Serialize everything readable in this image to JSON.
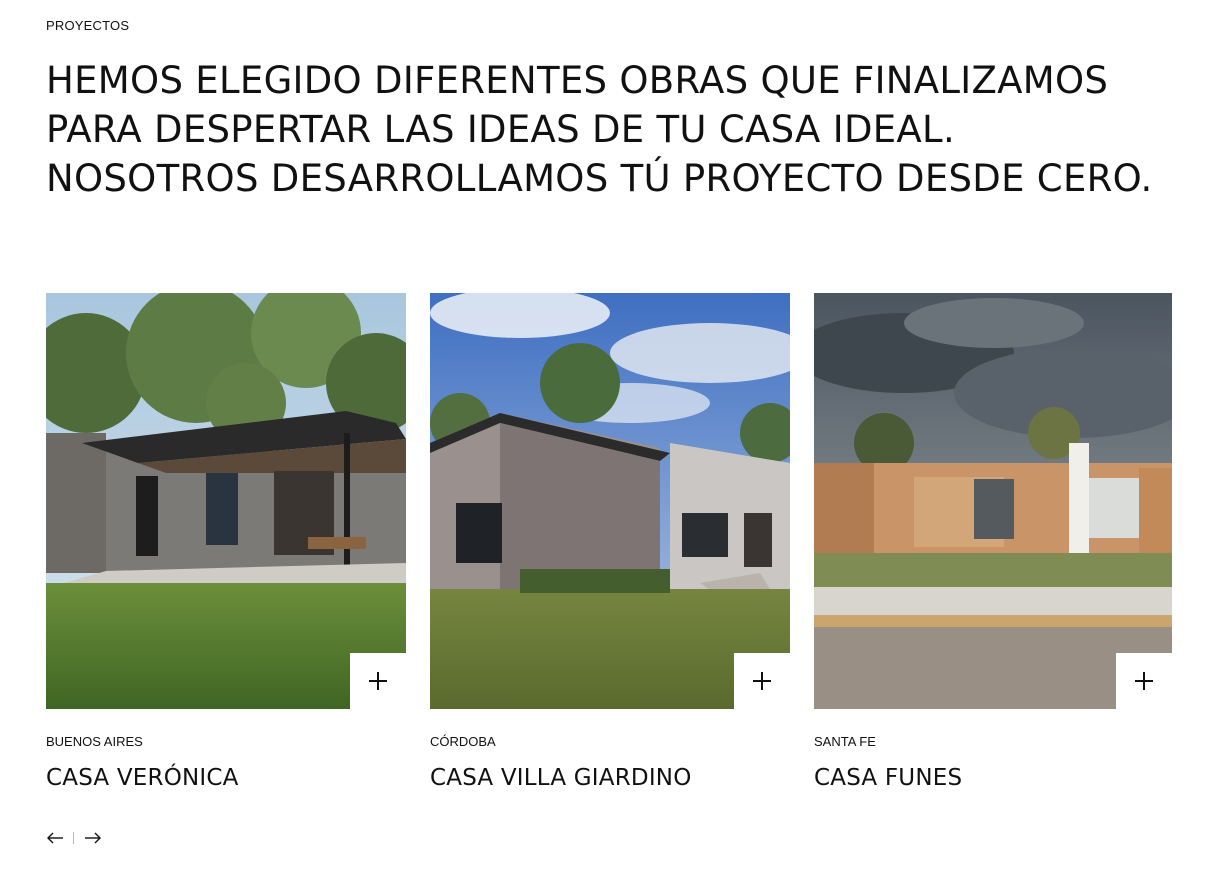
{
  "section": {
    "label": "PROYECTOS",
    "headline": "HEMOS ELEGIDO DIFERENTES OBRAS QUE FINALIZAMOS PARA DESPERTAR LAS IDEAS DE TU CASA IDEAL. NOSOTROS DESARROLLAMOS TÚ PROYECTO DESDE CERO."
  },
  "projects": [
    {
      "location": "BUENOS AIRES",
      "title": "CASA VERÓNICA",
      "image": "modern-house-render-with-lawn",
      "action_icon": "plus-icon"
    },
    {
      "location": "CÓRDOBA",
      "title": "CASA VILLA GIARDINO",
      "image": "stone-house-render-with-blue-sky",
      "action_icon": "plus-icon"
    },
    {
      "location": "SANTA FE",
      "title": "CASA FUNES",
      "image": "wooden-facade-house-render-with-cloudy-sky",
      "action_icon": "plus-icon"
    }
  ],
  "pager": {
    "prev_icon": "arrow-left-icon",
    "next_icon": "arrow-right-icon"
  },
  "colors": {
    "text": "#111111",
    "background": "#ffffff"
  }
}
